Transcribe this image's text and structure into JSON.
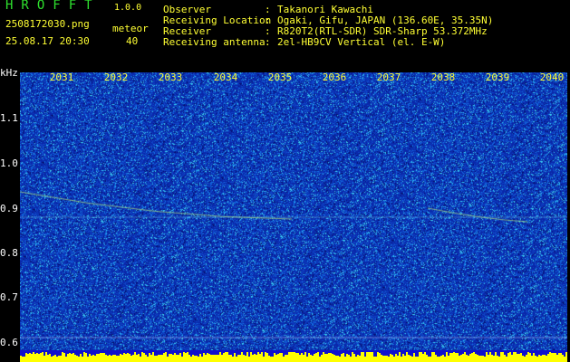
{
  "header": {
    "app_name": "HROFFT",
    "app_version": "1.0.0",
    "file_name": "2508172030.png",
    "date_time": "25.08.17 20:30",
    "meteor_label": "meteor",
    "meteor_count": "40"
  },
  "info": [
    {
      "label": "Observer",
      "value": "Takanori Kawachi"
    },
    {
      "label": "Receiving Location",
      "value": "Ogaki, Gifu, JAPAN (136.60E, 35.35N)"
    },
    {
      "label": "Receiver",
      "value": "R820T2(RTL-SDR) SDR-Sharp 53.372MHz"
    },
    {
      "label": "Receiving antenna",
      "value": "2el-HB9CV Vertical (el. E-W)"
    }
  ],
  "axes": {
    "unit": "kHz",
    "y_ticks": [
      "1.1",
      "1.0",
      "0.9",
      "0.8",
      "0.7",
      "0.6"
    ],
    "x_ticks": [
      "2031",
      "2032",
      "2033",
      "2034",
      "2035",
      "2036",
      "2037",
      "2038",
      "2039",
      "2040"
    ]
  },
  "colors": {
    "background": "#000000",
    "label_yellow": "#ffff33",
    "title_green": "#2ee02e",
    "spectrum_blue": "#1a3cc8"
  }
}
